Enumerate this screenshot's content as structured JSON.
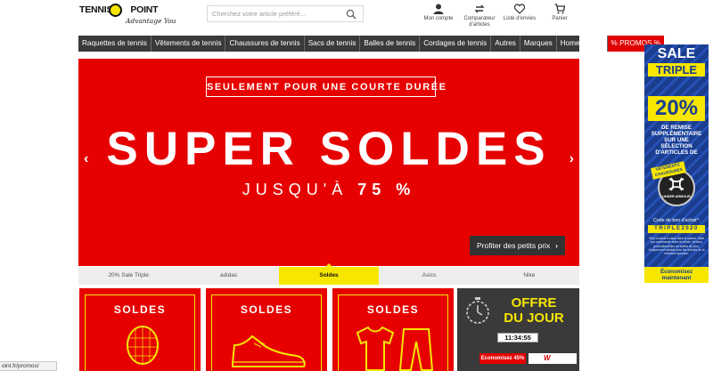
{
  "header": {
    "logo_line1": "TENNIS",
    "logo_line1b": "POINT",
    "logo_tagline": "Advantage You",
    "search_placeholder": "Cherchez votre article préféré...",
    "icons": [
      {
        "name": "account-icon",
        "label": "Mon compte"
      },
      {
        "name": "compare-icon",
        "label": "Comparateur d'articles"
      },
      {
        "name": "wishlist-icon",
        "label": "Liste d'envies"
      },
      {
        "name": "cart-icon",
        "label": "Panier"
      }
    ]
  },
  "nav": {
    "items": [
      "Raquettes de tennis",
      "Vêtements de tennis",
      "Chaussures de tennis",
      "Sacs de tennis",
      "Balles de tennis",
      "Cordages de tennis",
      "Autres",
      "Marques",
      "Home Sports",
      "% PROMOS %"
    ]
  },
  "hero": {
    "tag": "SEULEMENT POUR UNE COURTE DURÉE",
    "title": "SUPER SOLDES",
    "subtitle_prefix": "JUSQU'À",
    "subtitle_value": "75 %",
    "cta": "Profiter des petits prix",
    "prev": "‹",
    "next": "›"
  },
  "tabs": {
    "items": [
      "20% Sale Triple",
      "adidas",
      "Soldes",
      "Asics",
      "Nike"
    ],
    "active_index": 2
  },
  "cards": {
    "c1_title": "SOLDES",
    "c2_title": "SOLDES",
    "c3_title": "SOLDES"
  },
  "deal": {
    "line1": "OFFRE",
    "line2": "DU JOUR",
    "timer": "11:34:55",
    "saving": "Economisez 45%",
    "brand": "W"
  },
  "ad": {
    "sale": "SALE",
    "triple": "TRIPLE",
    "pct": "20%",
    "line1": "DE REMISE",
    "line2": "SUPPLÉMENTAIRE",
    "line3": "SUR UNE",
    "line4": "SÉLECTION",
    "line5": "D'ARTICLES DE",
    "ribbon": "VÊTEMENTS CHAUSSURES",
    "badge_brand": "UNDER ARMOUR",
    "code_label": "Code de bon d'achat*:",
    "code": "TRIPLE2020",
    "fine": "*Bon d'achat à saisir dans le panier. Valid par commande entre et article. Actions promotionnelles ne suffire de plus. Uniquement valable pour les articles de la sélection spéciale.",
    "btn_line1": "Économisez",
    "btn_line2": "maintenant"
  },
  "status_url": "oint.fr/promos/",
  "colors": {
    "brand_red": "#e60000",
    "brand_yellow": "#f6e600",
    "nav_dark": "#3a3a3a",
    "ad_blue": "#1a3d8f"
  }
}
